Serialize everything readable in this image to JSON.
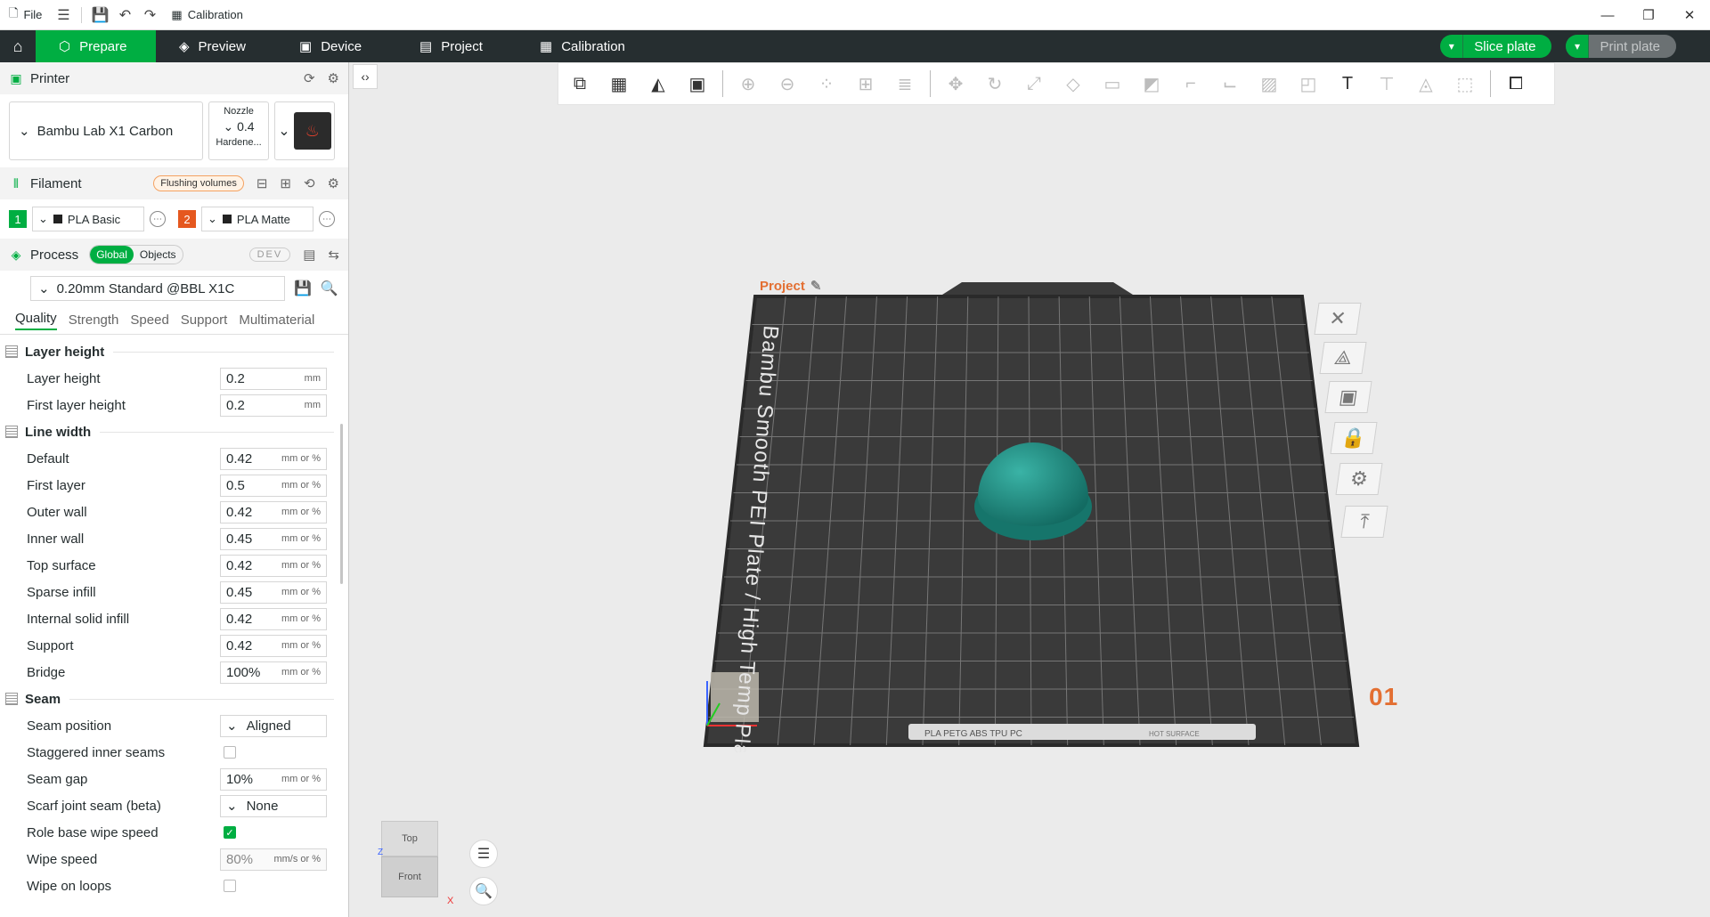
{
  "titlebar": {
    "file_label": "File",
    "tab_title": "Calibration"
  },
  "nav": {
    "tabs": [
      {
        "label": "Prepare",
        "icon": "cube-icon"
      },
      {
        "label": "Preview",
        "icon": "layers-icon"
      },
      {
        "label": "Device",
        "icon": "device-icon"
      },
      {
        "label": "Project",
        "icon": "list-icon"
      },
      {
        "label": "Calibration",
        "icon": "calibration-icon"
      }
    ],
    "slice_label": "Slice plate",
    "print_label": "Print plate"
  },
  "printer": {
    "section_title": "Printer",
    "name": "Bambu Lab X1 Carbon",
    "nozzle_title": "Nozzle",
    "nozzle_value": "0.4",
    "nozzle_type": "Hardene..."
  },
  "filament": {
    "section_title": "Filament",
    "flush_label": "Flushing volumes",
    "items": [
      {
        "num": "1",
        "color": "#00ae42",
        "name": "PLA Basic"
      },
      {
        "num": "2",
        "color": "#e5581f",
        "name": "PLA Matte"
      }
    ]
  },
  "process": {
    "section_title": "Process",
    "toggle_global": "Global",
    "toggle_objects": "Objects",
    "dev_label": "DEV",
    "preset": "0.20mm Standard @BBL X1C",
    "tabs": [
      "Quality",
      "Strength",
      "Speed",
      "Support",
      "Multimaterial"
    ]
  },
  "params": {
    "layer_height_group": "Layer height",
    "layer_height": {
      "label": "Layer height",
      "value": "0.2",
      "unit": "mm"
    },
    "first_layer_height": {
      "label": "First layer height",
      "value": "0.2",
      "unit": "mm"
    },
    "line_width_group": "Line width",
    "lw_default": {
      "label": "Default",
      "value": "0.42",
      "unit": "mm or %"
    },
    "lw_first": {
      "label": "First layer",
      "value": "0.5",
      "unit": "mm or %"
    },
    "lw_outer": {
      "label": "Outer wall",
      "value": "0.42",
      "unit": "mm or %"
    },
    "lw_inner": {
      "label": "Inner wall",
      "value": "0.45",
      "unit": "mm or %"
    },
    "lw_top": {
      "label": "Top surface",
      "value": "0.42",
      "unit": "mm or %"
    },
    "lw_sparse": {
      "label": "Sparse infill",
      "value": "0.45",
      "unit": "mm or %"
    },
    "lw_internal": {
      "label": "Internal solid infill",
      "value": "0.42",
      "unit": "mm or %"
    },
    "lw_support": {
      "label": "Support",
      "value": "0.42",
      "unit": "mm or %"
    },
    "lw_bridge": {
      "label": "Bridge",
      "value": "100%",
      "unit": "mm or %"
    },
    "seam_group": "Seam",
    "seam_position": {
      "label": "Seam position",
      "value": "Aligned"
    },
    "staggered": {
      "label": "Staggered inner seams"
    },
    "seam_gap": {
      "label": "Seam gap",
      "value": "10%",
      "unit": "mm or %"
    },
    "scarf": {
      "label": "Scarf joint seam (beta)",
      "value": "None"
    },
    "role_wipe": {
      "label": "Role base wipe speed"
    },
    "wipe_speed": {
      "label": "Wipe speed",
      "value": "80%",
      "unit": "mm/s or %"
    },
    "wipe_loops": {
      "label": "Wipe on loops"
    }
  },
  "viewport": {
    "plate_label": "Project",
    "plate_number": "01",
    "plate_text": "Bambu Smooth PEI Plate / High Temp Plate",
    "plate_footer": "PLA PETG ABS TPU PC",
    "hot_surface": "HOT SURFACE",
    "cube_top": "Top",
    "cube_front": "Front",
    "axis_x": "X",
    "axis_z": "Z",
    "model_color": "#1f8c80"
  }
}
